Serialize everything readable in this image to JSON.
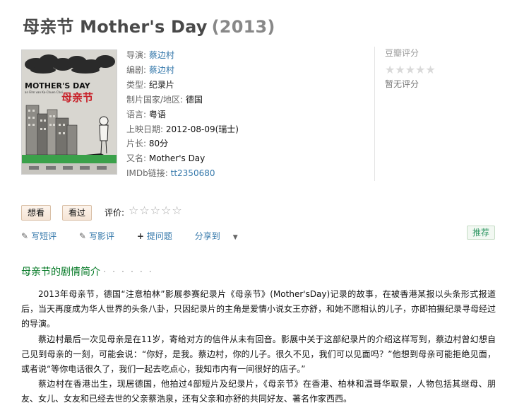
{
  "title": {
    "name": "母亲节 Mother's Day",
    "year": "(2013)"
  },
  "poster": {
    "title_en": "MOTHER'S DAY",
    "title_cn": "母亲节",
    "subtitle": "an Film van Ka-Chuen Choi"
  },
  "info": {
    "director_label": "导演:",
    "director": "蔡边村",
    "writer_label": "编剧:",
    "writer": "蔡边村",
    "genre_label": "类型:",
    "genre": "纪录片",
    "country_label": "制片国家/地区:",
    "country": "德国",
    "language_label": "语言:",
    "language": "粤语",
    "release_label": "上映日期:",
    "release": "2012-08-09(瑞士)",
    "runtime_label": "片长:",
    "runtime": "80分",
    "aka_label": "又名:",
    "aka": "Mother's Day",
    "imdb_label": "IMDb链接:",
    "imdb": "tt2350680"
  },
  "rating": {
    "label": "豆瓣评分",
    "stars": "★★★★★",
    "none": "暂无评分"
  },
  "buttons": {
    "want": "想看",
    "seen": "看过",
    "rate_label": "评价:",
    "rate_stars": "☆☆☆☆☆"
  },
  "actions": {
    "short_review": "写短评",
    "review": "写影评",
    "ask": "提问题",
    "share": "分享到",
    "recommend": "推荐"
  },
  "icons": {
    "pencil": "pencil-icon",
    "plus": "plus-icon",
    "share_arrow": "dropdown-arrow-icon"
  },
  "summary": {
    "heading": "母亲节的剧情简介",
    "dots": "· · · · · ·",
    "paragraphs": [
      "2013年母亲节，德国“注意柏林”影展参赛纪录片《母亲节》(Mother'sDay)记录的故事，在被香港某报以头条形式报道后，当天再度成为华人世界的头条八卦，只因纪录片的主角是爱情小说女王亦舒，和她不愿相认的儿子，亦即拍摄纪录寻母经过的导演。",
      "蔡边村最后一次见母亲是在11岁，寄给对方的信件从未有回音。影展中关于这部纪录片的介绍这样写到，蔡边村曾幻想自己见到母亲的一刻，可能会说：“你好，是我。蔡边村，你的儿子。很久不见，我们可以见面吗？”他想到母亲可能拒绝见面，或者说“等你电话很久了，我们一起去吃点心，我知市内有一间很好的店子。”",
      "蔡边村在香港出生，现居德国，他拍过4部短片及纪录片，《母亲节》在香港、柏林和温哥华取景，人物包括其继母、朋友、女儿、女友和已经去世的父亲蔡浩泉，还有父亲和亦舒的共同好友、著名作家西西。"
    ]
  },
  "colors": {
    "link": "#3377aa",
    "section": "#007722",
    "title": "#494949",
    "year": "#888888"
  }
}
